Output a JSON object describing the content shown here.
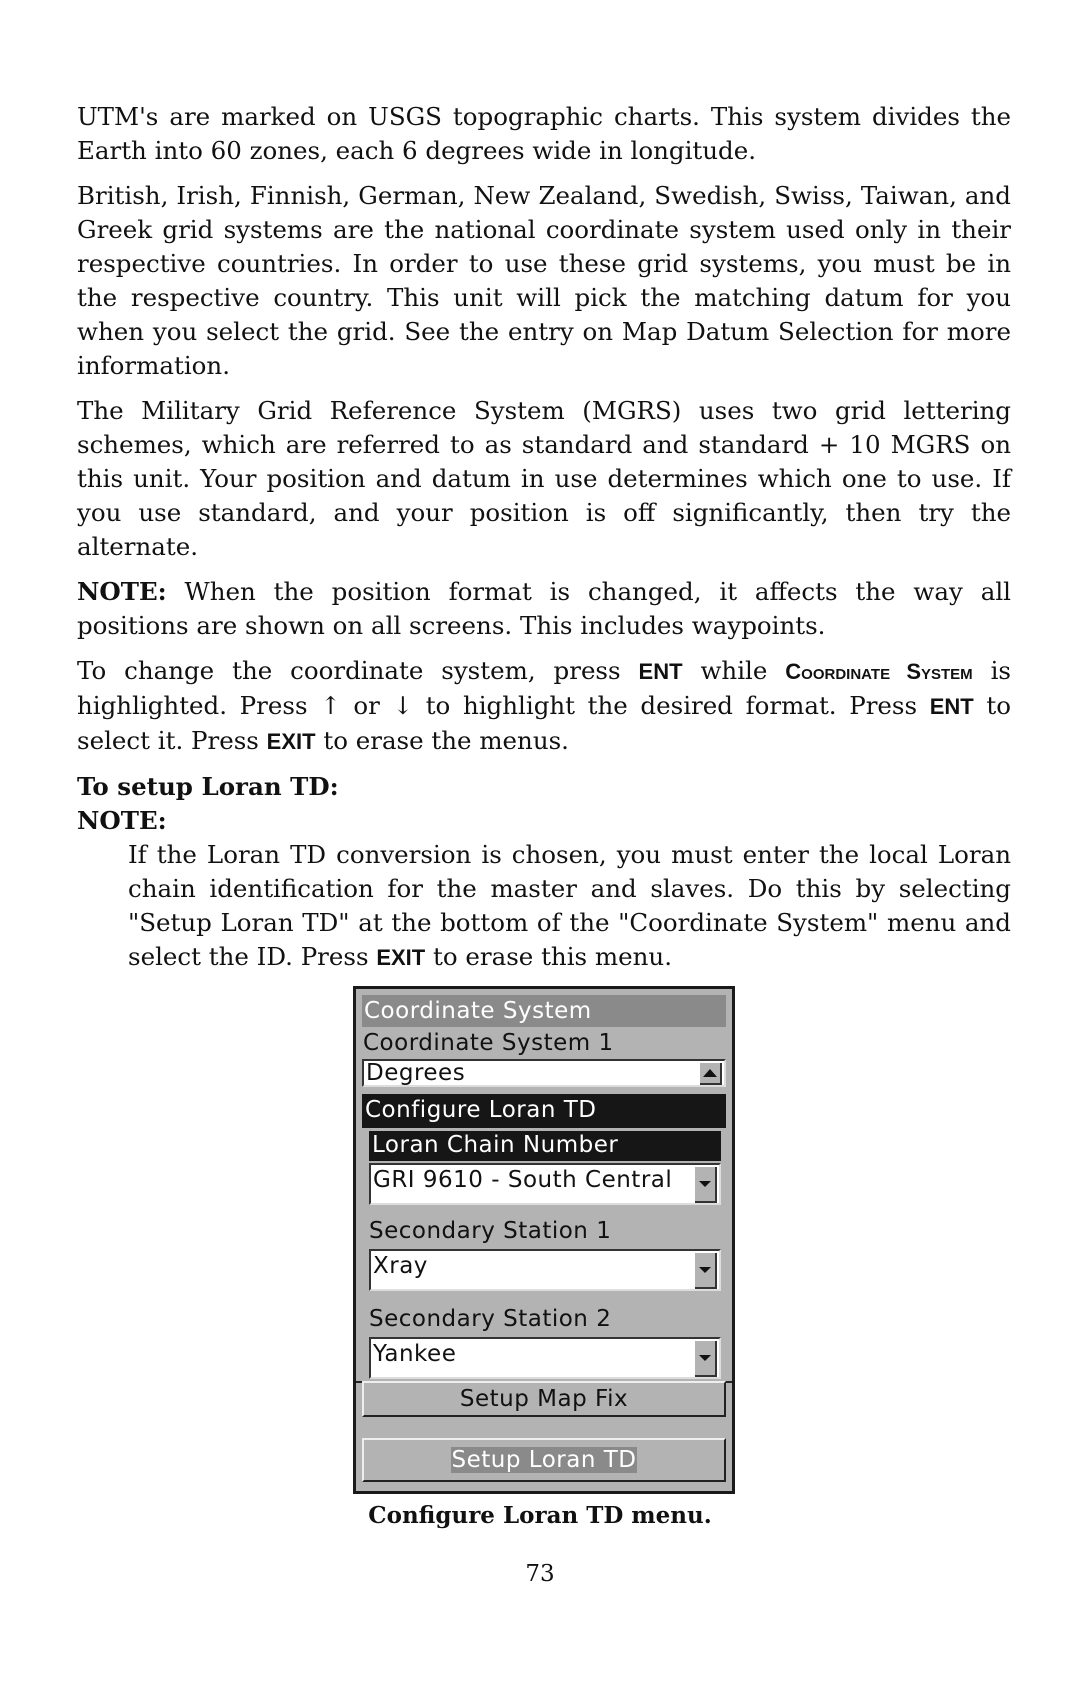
{
  "paragraphs": {
    "p1": "UTM's are marked on USGS topographic charts. This system divides the Earth into 60 zones, each 6 degrees wide in longitude.",
    "p2": "British, Irish, Finnish, German, New Zealand, Swedish, Swiss, Taiwan, and Greek grid systems are the national coordinate system used only in their respective countries. In order to use these grid systems, you must be in the respective country. This unit will pick the matching datum for you when you select the grid. See the entry on Map Datum Selection for more information.",
    "p3": "The Military Grid Reference System (MGRS) uses two grid lettering schemes, which are referred to as standard and standard + 10 MGRS on this unit. Your position and datum in use determines which one to use. If you use standard, and your position is off significantly, then try the alternate.",
    "p4_label": "NOTE:",
    "p4_text": " When the position format is changed, it affects the way all positions are shown on all screens. This includes waypoints.",
    "p5": {
      "a": "To change the coordinate system, press ",
      "key_ent": "ENT",
      "b": " while ",
      "menu_name": "Coordinate System",
      "c": " is highlighted. Press ",
      "up": "↑",
      "d": " or ",
      "down": "↓",
      "e": " to highlight the desired format. Press ",
      "key_ent2": "ENT",
      "f": " to select it. Press ",
      "key_exit": "EXIT",
      "g": " to erase the menus."
    },
    "heading": "To setup Loran TD:",
    "note_label": "NOTE:",
    "note_text_a": "If the Loran TD conversion is chosen, you must enter the local Loran chain identification for the master and slaves. Do this by selecting \"Setup Loran TD\" at the bottom of the \"Coordinate System\" menu and select the ID. Press ",
    "note_key_exit": "EXIT",
    "note_text_b": " to erase this menu."
  },
  "menu": {
    "title": "Coordinate System",
    "coord_label": "Coordinate System 1",
    "coord_value": "Degrees",
    "submenu_title": "Configure Loran TD",
    "chain_label": "Loran Chain Number",
    "chain_value": "GRI 9610 - South Central",
    "station1_label": "Secondary Station 1",
    "station1_value": "Xray",
    "station2_label": "Secondary Station 2",
    "station2_value": "Yankee",
    "btn_map_fix": "Setup Map Fix",
    "btn_loran": "Setup Loran TD"
  },
  "caption": "Configure Loran TD menu.",
  "page_number": "73"
}
